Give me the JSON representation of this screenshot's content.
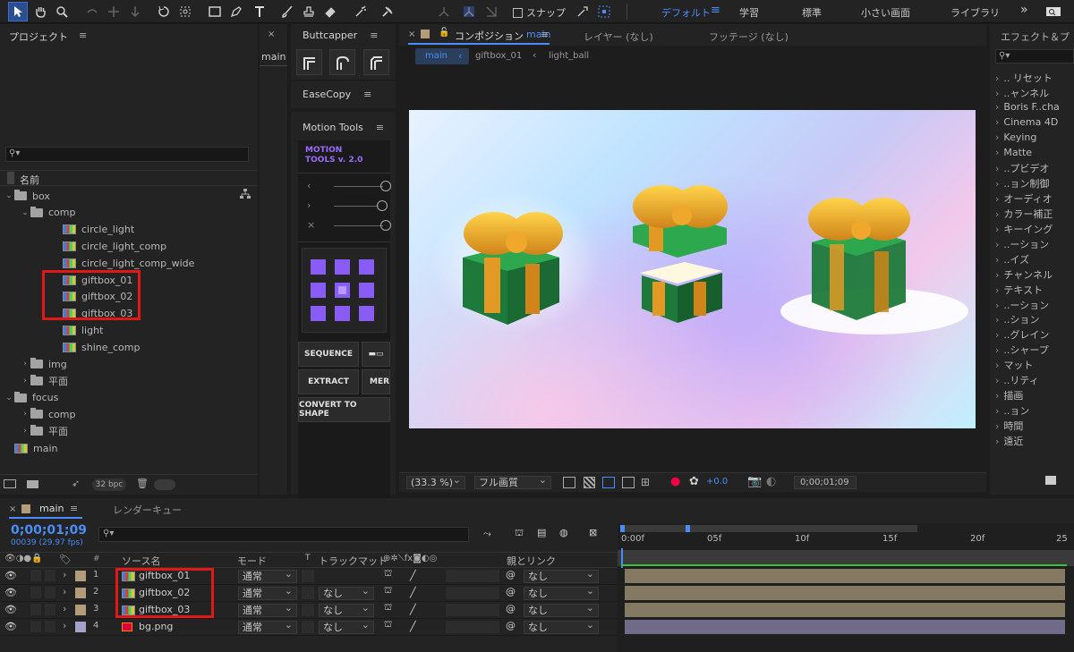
{
  "toolbar": {
    "snap_label": "スナップ",
    "workspaces": [
      "デフォルト",
      "学習",
      "標準",
      "小さい画面",
      "ライブラリ"
    ],
    "more": "»"
  },
  "project": {
    "title": "プロジェクト",
    "search_placeholder": "",
    "column_name": "名前",
    "tree": [
      {
        "label": "box",
        "type": "folder",
        "depth": 0,
        "expanded": true
      },
      {
        "label": "comp",
        "type": "folder",
        "depth": 1,
        "expanded": true
      },
      {
        "label": "circle_light",
        "type": "comp",
        "depth": 2
      },
      {
        "label": "circle_light_comp",
        "type": "comp",
        "depth": 2
      },
      {
        "label": "circle_light_comp_wide",
        "type": "comp",
        "depth": 2
      },
      {
        "label": "giftbox_01",
        "type": "comp",
        "depth": 2
      },
      {
        "label": "giftbox_02",
        "type": "comp",
        "depth": 2
      },
      {
        "label": "giftbox_03",
        "type": "comp",
        "depth": 2
      },
      {
        "label": "light",
        "type": "comp",
        "depth": 2
      },
      {
        "label": "shine_comp",
        "type": "comp",
        "depth": 2
      },
      {
        "label": "img",
        "type": "folder",
        "depth": 1,
        "expanded": false
      },
      {
        "label": "平面",
        "type": "folder",
        "depth": 1,
        "expanded": false
      },
      {
        "label": "focus",
        "type": "folder",
        "depth": 0,
        "expanded": true
      },
      {
        "label": "comp",
        "type": "folder",
        "depth": 1,
        "expanded": false
      },
      {
        "label": "平面",
        "type": "folder",
        "depth": 1,
        "expanded": false
      },
      {
        "label": "main",
        "type": "comp",
        "depth": 0
      }
    ],
    "bpc": "32 bpc"
  },
  "side_tab": {
    "label": "main"
  },
  "buttcapper": {
    "title": "Buttcapper"
  },
  "easecopy": {
    "title": "EaseCopy"
  },
  "motion_tools": {
    "title": "Motion Tools",
    "logo_line1": "MOTION",
    "logo_line2": "TOOLS v. 2.0",
    "buttons": [
      "SEQUENCE",
      "EXTRACT",
      "MERG",
      "CONVERT TO SHAPE"
    ],
    "accent": "#8a5cf6"
  },
  "composition": {
    "tab_label": "コンポジション",
    "tab_comp": "main",
    "layer_tab": "レイヤー (なし)",
    "footage_tab": "フッテージ (なし)",
    "breadcrumbs": [
      "main",
      "giftbox_01",
      "light_ball"
    ],
    "zoom": "(33.3 %)",
    "resolution": "フル画質",
    "exposure": "+0.0",
    "timecode": "0;00;01;09"
  },
  "effects": {
    "title": "エフェクト＆プ",
    "items": [
      ".. リセット",
      "..ャンネル",
      "Boris F..cha",
      "Cinema 4D",
      "Keying",
      "Matte",
      "..プビデオ",
      "..ョン制御",
      "オーディオ",
      "カラー補正",
      "キーイング",
      "..ーション",
      "..イズ",
      "チャンネル",
      "テキスト",
      "..ーション",
      "..ション",
      "..グレイン",
      "..シャープ",
      "マット",
      "..リティ",
      "描画",
      "..ョン",
      "時間",
      "遠近"
    ]
  },
  "timeline": {
    "tab": "main",
    "render_queue": "レンダーキュー",
    "timecode": "0;00;01;09",
    "frames": "00039 (29.97 fps)",
    "col_source": "ソース名",
    "col_mode": "モード",
    "col_t": "T",
    "col_trackmatte": "トラックマット",
    "col_parent": "親とリンク",
    "ruler": [
      "0:00f",
      "05f",
      "10f",
      "15f",
      "20f",
      "25"
    ],
    "layers": [
      {
        "num": "1",
        "name": "giftbox_01",
        "mode": "通常",
        "matte": "",
        "parent": "なし",
        "label": "#b29c7a"
      },
      {
        "num": "2",
        "name": "giftbox_02",
        "mode": "通常",
        "matte": "なし",
        "parent": "なし",
        "label": "#b29c7a"
      },
      {
        "num": "3",
        "name": "giftbox_03",
        "mode": "通常",
        "matte": "なし",
        "parent": "なし",
        "label": "#b29c7a"
      },
      {
        "num": "4",
        "name": "bg.png",
        "mode": "通常",
        "matte": "なし",
        "parent": "なし",
        "label": "#a5a2c9"
      }
    ]
  }
}
